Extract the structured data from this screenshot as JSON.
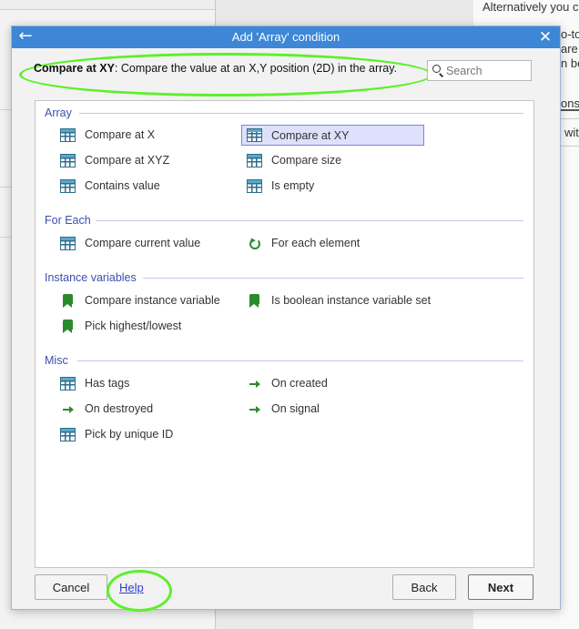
{
  "background": {
    "right_text": [
      "Alternatively you c",
      "o-to",
      "are",
      "n be",
      "ons",
      "wit"
    ]
  },
  "dialog": {
    "title": "Add 'Array' condition",
    "back_icon": "arrow-left-icon",
    "close_icon": "close-icon",
    "description": {
      "name": "Compare at XY",
      "text": ": Compare the value at an X,Y position (2D) in the array."
    },
    "search": {
      "placeholder": "Search",
      "value": ""
    },
    "categories": [
      {
        "name": "Array",
        "items": [
          {
            "label": "Compare at X",
            "icon": "array-grid-icon"
          },
          {
            "label": "Compare at XY",
            "icon": "array-grid-icon",
            "selected": true
          },
          {
            "label": "Compare at XYZ",
            "icon": "array-grid-icon"
          },
          {
            "label": "Compare size",
            "icon": "array-grid-icon"
          },
          {
            "label": "Contains value",
            "icon": "array-grid-icon"
          },
          {
            "label": "Is empty",
            "icon": "array-grid-icon"
          }
        ]
      },
      {
        "name": "For Each",
        "items": [
          {
            "label": "Compare current value",
            "icon": "array-grid-icon"
          },
          {
            "label": "For each element",
            "icon": "loop-icon"
          }
        ]
      },
      {
        "name": "Instance variables",
        "items": [
          {
            "label": "Compare instance variable",
            "icon": "shield-icon"
          },
          {
            "label": "Is boolean instance variable set",
            "icon": "shield-icon"
          },
          {
            "label": "Pick highest/lowest",
            "icon": "shield-icon"
          }
        ]
      },
      {
        "name": "Misc",
        "items": [
          {
            "label": "Has tags",
            "icon": "array-grid-icon"
          },
          {
            "label": "On created",
            "icon": "trigger-arrow-icon"
          },
          {
            "label": "On destroyed",
            "icon": "trigger-arrow-icon"
          },
          {
            "label": "On signal",
            "icon": "trigger-arrow-icon"
          },
          {
            "label": "Pick by unique ID",
            "icon": "array-grid-icon"
          }
        ]
      }
    ],
    "buttons": {
      "cancel": "Cancel",
      "help": "Help",
      "back": "Back",
      "next": "Next"
    },
    "annotation_color": "#5cf02a",
    "accent_color": "#3d87d6"
  }
}
